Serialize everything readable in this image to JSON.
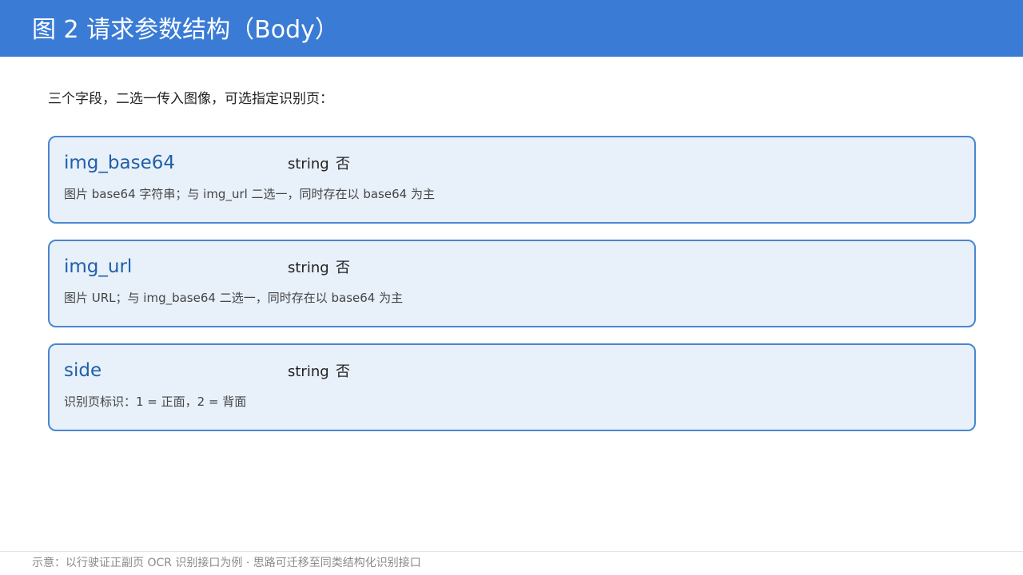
{
  "header": {
    "title": "图 2  请求参数结构（Body）"
  },
  "intro": "三个字段，二选一传入图像，可选指定识别页：",
  "fields": [
    {
      "name": "img_base64",
      "type": "string",
      "required": "否",
      "description": "图片 base64 字符串；与 img_url 二选一，同时存在以 base64 为主"
    },
    {
      "name": "img_url",
      "type": "string",
      "required": "否",
      "description": "图片 URL；与 img_base64 二选一，同时存在以 base64 为主"
    },
    {
      "name": "side",
      "type": "string",
      "required": "否",
      "description": "识别页标识：1 = 正面，2 = 背面"
    }
  ],
  "footer": {
    "note": "示意：以行驶证正副页 OCR 识别接口为例 · 思路可迁移至同类结构化识别接口"
  },
  "colors": {
    "header_background": "#3a7bd5",
    "card_background": "#e8f0fa",
    "card_border": "#4a86d0",
    "field_name": "#1f5fa8"
  }
}
